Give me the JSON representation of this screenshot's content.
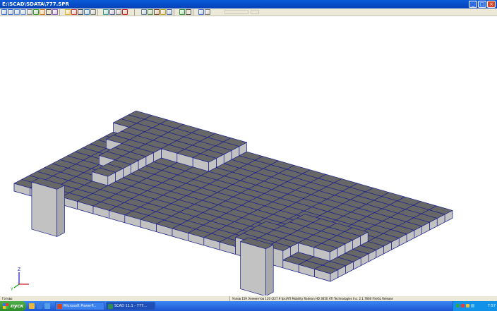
{
  "window": {
    "title": "E:\\SCAD\\SDATA\\777.SPR",
    "min_symbol": "_",
    "max_symbol": "□",
    "close_symbol": "×"
  },
  "toolbar": {
    "icons": [
      "zoom-in-icon",
      "zoom-out-icon",
      "zoom-window-icon",
      "zoom-extent-icon",
      "zoom-prev-icon",
      "pan-icon",
      "rotate-icon",
      "cursor-icon",
      "shading-icon",
      "fill-icon",
      "color-icon",
      "node-numbers-icon",
      "element-numbers-icon",
      "filter-icon",
      "fragment-icon",
      "layers-icon",
      "grid-icon",
      "axes-icon",
      "camera-icon",
      "dimension-icon",
      "link-icon",
      "key-icon",
      "section-icon",
      "refresh-icon",
      "print-icon",
      "help-icon",
      "settings-icon"
    ]
  },
  "statusbar": {
    "left": "Готово",
    "info": "Узлов 159  Элементов 120  (227.9 fps)ATI Mobility Radeon HD 3650 ATI Technologies Inc. 2.1.7660 FireGL Release"
  },
  "taskbar": {
    "start_label": "пуск",
    "tasks": [
      {
        "label": "Microsoft PowerP...",
        "color": "#d24726"
      },
      {
        "label": "SCAD 11.1 - 777...",
        "color": "#2e8b57"
      }
    ],
    "clock": "7:57"
  },
  "colors": {
    "slab_top": "#676767",
    "slab_side": "#c2c2c2",
    "edge": "#1a1f8c",
    "title_bar": "#0a5bd8",
    "taskbar": "#245edb"
  }
}
